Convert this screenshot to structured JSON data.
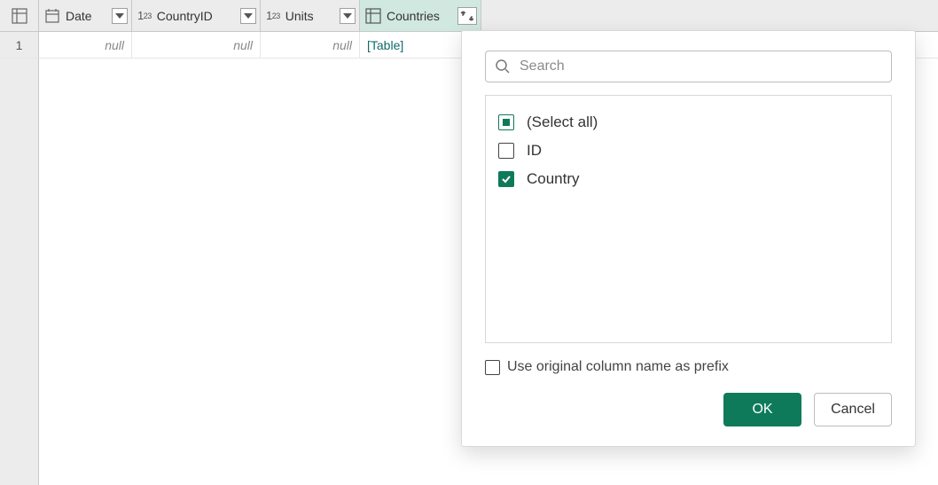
{
  "columns": [
    {
      "name": "Date",
      "type": "date"
    },
    {
      "name": "CountryID",
      "type": "number"
    },
    {
      "name": "Units",
      "type": "number"
    },
    {
      "name": "Countries",
      "type": "table",
      "active": true
    }
  ],
  "rows": [
    {
      "n": "1",
      "date": "null",
      "countryid": "null",
      "units": "null",
      "countries": "[Table]"
    }
  ],
  "expand_panel": {
    "search_placeholder": "Search",
    "select_all_label": "(Select all)",
    "fields": [
      {
        "label": "ID",
        "checked": false
      },
      {
        "label": "Country",
        "checked": true
      }
    ],
    "prefix_label": "Use original column name as prefix",
    "prefix_checked": false,
    "ok_label": "OK",
    "cancel_label": "Cancel"
  }
}
